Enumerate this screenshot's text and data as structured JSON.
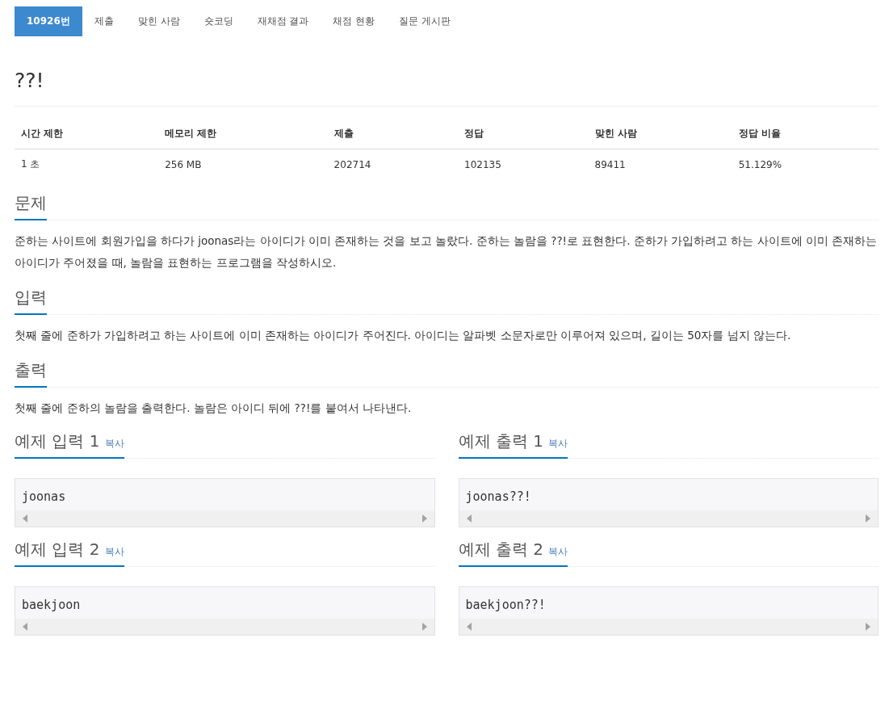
{
  "tabs": [
    {
      "label": "10926번",
      "selected": true
    },
    {
      "label": "제출",
      "selected": false
    },
    {
      "label": "맞힌 사람",
      "selected": false
    },
    {
      "label": "숏코딩",
      "selected": false
    },
    {
      "label": "재채점 결과",
      "selected": false
    },
    {
      "label": "채점 현황",
      "selected": false
    },
    {
      "label": "질문 게시판",
      "selected": false
    }
  ],
  "title": "??!",
  "info_table": {
    "columns": [
      "시간 제한",
      "메모리 제한",
      "제출",
      "정답",
      "맞힌 사람",
      "정답 비율"
    ],
    "rows": [
      [
        "1 초",
        "256 MB",
        "202714",
        "102135",
        "89411",
        "51.129%"
      ]
    ]
  },
  "sections": [
    {
      "heading": "문제",
      "text": "준하는 사이트에 회원가입을 하다가 joonas라는 아이디가 이미 존재하는 것을 보고 놀랐다. 준하는 놀람을 ??!로 표현한다. 준하가 가입하려고 하는 사이트에 이미 존재하는 아이디가 주어졌을 때, 놀람을 표현하는 프로그램을 작성하시오."
    },
    {
      "heading": "입력",
      "text": "첫째 줄에 준하가 가입하려고 하는 사이트에 이미 존재하는 아이디가 주어진다. 아이디는 알파벳 소문자로만 이루어져 있으며, 길이는 50자를 넘지 않는다."
    },
    {
      "heading": "출력",
      "text": "첫째 줄에 준하의 놀람을 출력한다. 놀람은 아이디 뒤에 ??!를 붙여서 나타낸다."
    }
  ],
  "samples": [
    {
      "input_heading": "예제 입력 1",
      "input_copy": "복사",
      "input": "joonas",
      "output_heading": "예제 출력 1",
      "output_copy": "복사",
      "output": "joonas??!"
    },
    {
      "input_heading": "예제 입력 2",
      "input_copy": "복사",
      "input": "baekjoon",
      "output_heading": "예제 출력 2",
      "output_copy": "복사",
      "output": "baekjoon??!"
    }
  ]
}
